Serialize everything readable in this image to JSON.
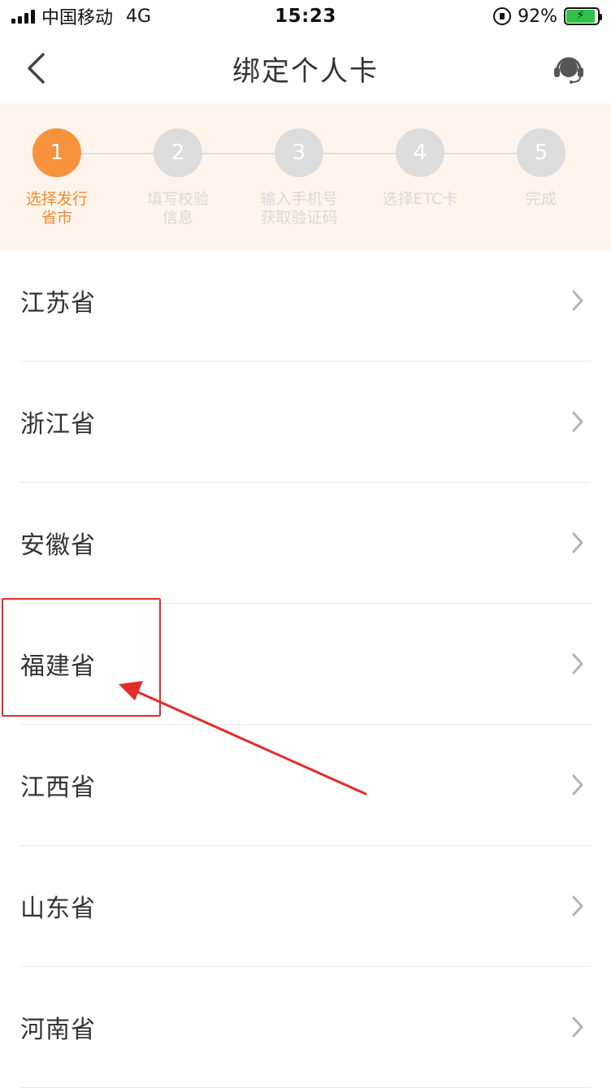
{
  "status_bar": {
    "carrier": "中国移动",
    "network": "4G",
    "time": "15:23",
    "battery": "92%",
    "battery_level": 0.92
  },
  "header": {
    "title": "绑定个人卡"
  },
  "steps": [
    {
      "number": "1",
      "label_line1": "选择发行",
      "label_line2": "省市",
      "active": true
    },
    {
      "number": "2",
      "label_line1": "填写校验",
      "label_line2": "信息",
      "active": false
    },
    {
      "number": "3",
      "label_line1": "输入手机号",
      "label_line2": "获取验证码",
      "active": false
    },
    {
      "number": "4",
      "label_line1": "选择ETC卡",
      "label_line2": "",
      "active": false
    },
    {
      "number": "5",
      "label_line1": "完成",
      "label_line2": "",
      "active": false
    }
  ],
  "provinces": [
    {
      "name": "江苏省"
    },
    {
      "name": "浙江省"
    },
    {
      "name": "安徽省"
    },
    {
      "name": "福建省"
    },
    {
      "name": "江西省"
    },
    {
      "name": "山东省"
    },
    {
      "name": "河南省"
    }
  ],
  "colors": {
    "accent": "#f7913b",
    "stepper_bg": "#fff4ec",
    "inactive": "#dcdcdc",
    "annotation": "#e32b2b"
  },
  "icons": {
    "back": "chevron-left-icon",
    "support": "headset-icon",
    "row": "chevron-right-icon"
  }
}
